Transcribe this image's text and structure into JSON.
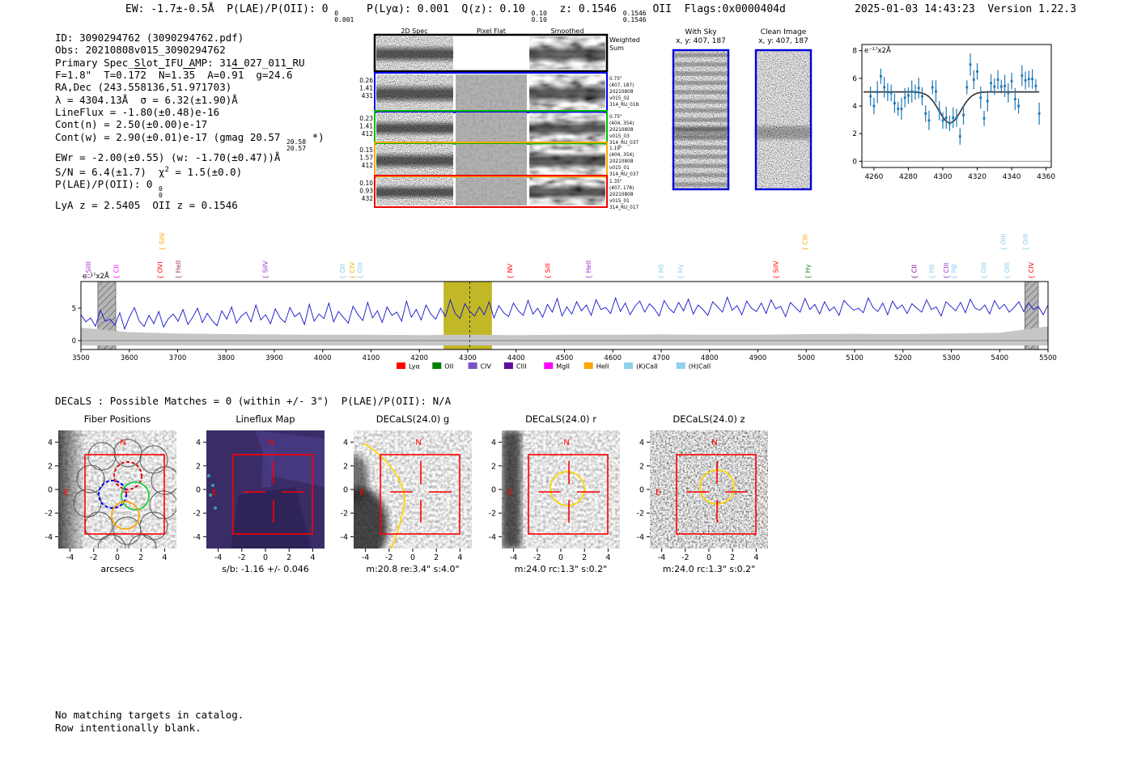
{
  "header": {
    "left_segments": [
      {
        "t": "EW: -1.7±-0.5Å  P(LAE)/P(OII): 0 "
      },
      {
        "stack": [
          "0",
          "0.001"
        ]
      },
      {
        "t": "  P(Lyα): 0.001  Q(z): 0.10 "
      },
      {
        "stack": [
          "0.10",
          "0.10"
        ]
      },
      {
        "t": "  z: 0.1546 "
      },
      {
        "stack": [
          "0.1546",
          "0.1546"
        ]
      },
      {
        "t": " OII  Flags:0x0000404d"
      }
    ],
    "right": "2025-01-03 14:43:23  Version 1.22.3"
  },
  "info_lines": [
    [
      {
        "t": "ID: 3090294762 (3090294762.pdf)"
      }
    ],
    [
      {
        "t": "Obs: 20210808v015_3090294762"
      }
    ],
    [
      {
        "t": "Primary Spec_Slot_IFU_AMP: 314_027_011_RU"
      }
    ],
    [
      {
        "t": "F=1.8\"  T=0.1"
      },
      {
        "t": "72",
        "over": true
      },
      {
        "t": "  "
      },
      {
        "t": "N",
        "over": true
      },
      {
        "t": "=1."
      },
      {
        "t": "35",
        "over": true
      },
      {
        "t": "  A=0."
      },
      {
        "t": "91",
        "over": true
      },
      {
        "t": "  g=24."
      },
      {
        "t": "6",
        "over": true
      }
    ],
    [
      {
        "t": "RA,Dec (243.558136,51.971703)"
      }
    ],
    [
      {
        "t": "λ = 4304.13Å  σ = 6.32(±1.90)Å"
      }
    ],
    [
      {
        "t": "LineFlux = -1.80(±0.48)e-16"
      }
    ],
    [
      {
        "t": "Cont(n) = 2.50(±0.00)e-17"
      }
    ],
    [
      {
        "t": "Cont(w) = 2.90(±0.01)e-17 (gmag 20.57 "
      },
      {
        "stack": [
          "20.58",
          "20.57"
        ]
      },
      {
        "t": " *)"
      }
    ],
    [
      {
        "t": "EWr = -2.00(±0.55) (w: -1.70(±0.47))Å"
      }
    ],
    [
      {
        "t": "S/N = 6.4(±1.7)  χ"
      },
      {
        "sup": "2"
      },
      {
        "t": " = 1.5(±0.0)"
      }
    ],
    [
      {
        "t": "P(LAE)/P(OII): 0 "
      },
      {
        "stack": [
          "0",
          "0"
        ]
      }
    ],
    [
      {
        "t": "LyA z = 2.5405  OII z = 0.1546"
      }
    ]
  ],
  "spec2d": {
    "columns": [
      "2D Spec",
      "Pixel Flat",
      "Smoothed"
    ],
    "rows": [
      {
        "border": "#000000",
        "left": [],
        "right": [
          "Weighted",
          "Sum"
        ]
      },
      {
        "border": "#0000ee",
        "left": [
          "0.26",
          "1.41",
          "431"
        ],
        "right": [
          "0.75\"",
          "(407, 187)",
          "20210808",
          "v015_02",
          "314_RU_018"
        ]
      },
      {
        "border": "#00bb00",
        "left": [
          "0.23",
          "1.41",
          "412"
        ],
        "right": [
          "0.75\"",
          "(404, 354)",
          "20210808",
          "v015_03",
          "314_RU_037"
        ]
      },
      {
        "border": "#ffa500",
        "left": [
          "0.15",
          "1.57",
          "412"
        ],
        "right": [
          "1.19\"",
          "(404, 354)",
          "20210808",
          "v015_01",
          "314_RU_037"
        ]
      },
      {
        "border": "#ee0000",
        "left": [
          "0.10",
          "0.93",
          "432"
        ],
        "right": [
          "1.35\"",
          "(407, 178)",
          "20210808",
          "v015_01",
          "314_RU_017"
        ]
      }
    ]
  },
  "sky_panels": {
    "with_sky_title": "With Sky",
    "with_sky_sub": "x, y: 407, 187",
    "clean_title": "Clean Image",
    "clean_sub": "x, y: 407, 187",
    "border_color": "#0000dd"
  },
  "decals": {
    "match_line": "DECaLS : Possible Matches = 0 (within +/- 3\")  P(LAE)/P(OII): N/A"
  },
  "footer_lines": [
    "No matching targets in catalog.",
    "Row intentionally blank."
  ],
  "chart_data": [
    {
      "id": "line_fit",
      "type": "scatter",
      "inset_label": "e⁻¹⁷x2Å",
      "xlim": [
        4253,
        4363
      ],
      "ylim": [
        -0.45,
        8.45
      ],
      "x_ticks": [
        4260,
        4280,
        4300,
        4320,
        4340,
        4360
      ],
      "y_ticks": [
        0,
        2,
        4,
        6,
        8
      ],
      "point_color": "#1f77b4",
      "fit_color": "#3a3a3a",
      "fit": {
        "continuum": 5.02,
        "center": 4304.13,
        "sigma": 6.32,
        "depth": 2.25
      },
      "x_start": 4258,
      "x_step": 2,
      "points_y": [
        4.7,
        4.0,
        5.0,
        6.15,
        5.35,
        5.0,
        4.95,
        4.2,
        3.8,
        3.8,
        4.6,
        4.75,
        5.05,
        5.0,
        5.3,
        4.7,
        3.45,
        2.95,
        5.35,
        5.05,
        3.65,
        2.95,
        3.15,
        2.75,
        3.15,
        3.15,
        1.8,
        3.35,
        5.35,
        7.0,
        5.9,
        6.5,
        4.6,
        3.1,
        4.35,
        5.65,
        5.4,
        5.9,
        5.4,
        5.45,
        4.95,
        5.8,
        4.5,
        4.0,
        6.2,
        5.85,
        5.95,
        5.95,
        5.45,
        3.45
      ],
      "points_err_cycle": [
        0.7,
        0.6,
        0.8,
        0.55,
        0.75,
        0.65,
        0.6,
        0.7,
        0.5,
        0.8
      ]
    },
    {
      "id": "main_spectrum",
      "type": "line",
      "inset_label": "e⁻¹⁷x2Å",
      "xlim": [
        3500,
        5500
      ],
      "ylim": [
        -1.4,
        9.1
      ],
      "x_ticks": [
        3500,
        3600,
        3700,
        3800,
        3900,
        4000,
        4100,
        4200,
        4300,
        4400,
        4500,
        4600,
        4700,
        4800,
        4900,
        5000,
        5100,
        5200,
        5300,
        5400,
        5500
      ],
      "y_ticks": [
        0,
        5
      ],
      "line_color": "#1414cc",
      "highlight": {
        "x0": 4250,
        "x1": 4350,
        "line_x": 4304.13,
        "color": "#bfb31b"
      },
      "masked_bands": [
        [
          3535,
          3572
        ],
        [
          5452,
          5480
        ]
      ],
      "err_band_top": [
        2.0,
        1.3,
        1.1,
        1.0,
        0.95,
        0.9,
        0.9,
        0.85,
        0.9,
        0.85,
        0.9,
        0.9,
        0.95,
        0.9,
        0.9,
        1.0,
        1.05,
        1.0,
        1.1,
        1.2,
        2.2
      ],
      "flux": [
        4.0,
        2.9,
        3.5,
        2.2,
        4.7,
        3.0,
        3.3,
        2.4,
        4.3,
        1.8,
        3.7,
        5.1,
        3.0,
        2.2,
        3.9,
        2.6,
        4.5,
        2.1,
        3.4,
        4.1,
        3.0,
        4.8,
        2.5,
        3.6,
        5.0,
        2.8,
        4.2,
        3.1,
        2.3,
        4.6,
        3.3,
        5.2,
        2.7,
        3.8,
        4.4,
        2.9,
        5.5,
        3.2,
        4.0,
        2.6,
        4.9,
        3.5,
        2.8,
        5.1,
        3.7,
        4.3,
        2.5,
        5.6,
        3.0,
        4.1,
        3.4,
        5.8,
        2.9,
        4.5,
        3.6,
        2.7,
        5.3,
        4.0,
        3.1,
        5.9,
        3.5,
        4.6,
        2.8,
        5.2,
        3.9,
        4.4,
        3.0,
        6.1,
        3.6,
        4.8,
        3.2,
        5.5,
        4.1,
        3.3,
        5.0,
        3.7,
        6.3,
        4.2,
        3.4,
        5.7,
        4.5,
        3.8,
        5.2,
        4.0,
        6.0,
        3.5,
        5.4,
        4.3,
        3.7,
        5.8,
        4.6,
        3.9,
        6.2,
        4.1,
        5.0,
        3.6,
        5.6,
        4.4,
        6.5,
        3.8,
        5.2,
        4.1,
        6.0,
        4.6,
        5.5,
        3.9,
        6.3,
        4.8,
        5.1,
        4.2,
        6.6,
        4.5,
        5.8,
        4.0,
        5.3,
        6.1,
        4.4,
        5.7,
        4.9,
        3.8,
        6.2,
        5.0,
        4.3,
        5.9,
        4.6,
        6.4,
        4.1,
        5.5,
        4.8,
        3.9,
        6.0,
        5.2,
        4.4,
        6.7,
        4.7,
        5.4,
        4.0,
        6.1,
        5.0,
        4.5,
        5.8,
        4.2,
        6.3,
        4.9,
        5.3,
        3.7,
        5.9,
        5.1,
        4.4,
        6.5,
        4.8,
        5.6,
        4.1,
        6.0,
        4.6,
        5.2,
        3.9,
        6.2,
        5.4,
        4.7,
        5.0,
        4.3,
        6.6,
        5.1,
        4.5,
        5.8,
        4.0,
        6.1,
        4.9,
        5.5,
        4.2,
        5.7,
        5.0,
        4.4,
        6.3,
        4.8,
        5.2,
        3.8,
        6.0,
        5.3,
        4.6,
        5.9,
        4.3,
        6.4,
        5.0,
        4.7,
        5.5,
        4.1,
        6.2,
        4.9,
        5.6,
        4.4,
        5.1,
        6.0,
        4.5,
        5.8,
        4.8,
        5.3,
        4.0,
        5.5
      ],
      "line_labels": [
        {
          "label": "SiIII",
          "wl": 3520,
          "color": "#9a32cd",
          "row": 0
        },
        {
          "label": "CII",
          "wl": 3578,
          "color": "#ff00ff",
          "row": 0
        },
        {
          "label": "SiIV",
          "wl": 3672,
          "color": "#ffa500",
          "row": 1
        },
        {
          "label": "OVI",
          "wl": 3668,
          "color": "#ff0000",
          "row": 0
        },
        {
          "label": "HeII",
          "wl": 3706,
          "color": "#a03568",
          "row": 0
        },
        {
          "label": "SiIV",
          "wl": 3886,
          "color": "#9a32cd",
          "row": 0
        },
        {
          "label": "OII",
          "wl": 4046,
          "color": "#87ceeb",
          "row": 0
        },
        {
          "label": "CIV",
          "wl": 4066,
          "color": "#ffa500",
          "row": 0
        },
        {
          "label": "OIII",
          "wl": 4082,
          "color": "#87ceeb",
          "row": 0
        },
        {
          "label": "NV",
          "wl": 4392,
          "color": "#ff0000",
          "row": 0
        },
        {
          "label": "SiII",
          "wl": 4470,
          "color": "#ff0000",
          "row": 0
        },
        {
          "label": "HeII",
          "wl": 4554,
          "color": "#9a32cd",
          "row": 0
        },
        {
          "label": "Hδ",
          "wl": 4704,
          "color": "#87ceeb",
          "row": 0
        },
        {
          "label": "Hγ",
          "wl": 4744,
          "color": "#87ceeb",
          "row": 0
        },
        {
          "label": "SiIV",
          "wl": 4942,
          "color": "#ff0000",
          "row": 0
        },
        {
          "label": "CIII",
          "wl": 5002,
          "color": "#ffa500",
          "row": 1
        },
        {
          "label": "Hγ",
          "wl": 5008,
          "color": "#228b22",
          "row": 0
        },
        {
          "label": "CII",
          "wl": 5228,
          "color": "#8b008b",
          "row": 0
        },
        {
          "label": "Hδ",
          "wl": 5264,
          "color": "#87ceeb",
          "row": 0
        },
        {
          "label": "CIII",
          "wl": 5294,
          "color": "#9a32cd",
          "row": 0
        },
        {
          "label": "Hβ",
          "wl": 5310,
          "color": "#87ceeb",
          "row": 0
        },
        {
          "label": "OIII",
          "wl": 5372,
          "color": "#87ceeb",
          "row": 0
        },
        {
          "label": "OIII",
          "wl": 5420,
          "color": "#87ceeb",
          "row": 0
        },
        {
          "label": "OIII",
          "wl": 5412,
          "color": "#87ceeb",
          "row": 1
        },
        {
          "label": "OIII",
          "wl": 5458,
          "color": "#87ceeb",
          "row": 1
        },
        {
          "label": "CIV",
          "wl": 5470,
          "color": "#ff0000",
          "row": 0
        }
      ],
      "legend": [
        {
          "label": "Lyα",
          "color": "#ff0000"
        },
        {
          "label": "OII",
          "color": "#008000"
        },
        {
          "label": "CIV",
          "color": "#7a52c7"
        },
        {
          "label": "CIII",
          "color": "#5d0f9e"
        },
        {
          "label": "MgII",
          "color": "#ff00ff"
        },
        {
          "label": "HeII",
          "color": "#ffa500"
        },
        {
          "label": "(K)CaII",
          "color": "#8ed1ee"
        },
        {
          "label": "(H)CaII",
          "color": "#8ed1ee"
        }
      ]
    }
  ],
  "cutouts": [
    {
      "id": "fiber",
      "title": "Fiber Positions",
      "xlabel": "arcsecs",
      "x_ticks": [
        -4,
        -2,
        0,
        2,
        4
      ],
      "y_ticks": [
        4,
        2,
        0,
        -2,
        -4
      ],
      "north": "N",
      "east": "E"
    },
    {
      "id": "lineflux",
      "title": "Lineflux Map",
      "xlabel": "s/b: -1.16 +/- 0.046",
      "x_ticks": [
        -4,
        -2,
        0,
        2,
        4
      ],
      "y_ticks": [
        4,
        2,
        0,
        -2,
        -4
      ],
      "north": "N",
      "east": "E"
    },
    {
      "id": "decals_g",
      "title": "DECaLS(24.0) g",
      "xlabel": "m:20.8 re:3.4\" s:4.0\"",
      "x_ticks": [
        -4,
        -2,
        0,
        2,
        4
      ],
      "y_ticks": [
        4,
        2,
        0,
        -2,
        -4
      ],
      "north": "N",
      "east": "E"
    },
    {
      "id": "decals_r",
      "title": "DECaLS(24.0) r",
      "xlabel": "m:24.0 rc:1.3\" s:0.2\"",
      "x_ticks": [
        -4,
        -2,
        0,
        2,
        4
      ],
      "y_ticks": [
        4,
        2,
        0,
        -2,
        -4
      ],
      "north": "N",
      "east": "E"
    },
    {
      "id": "decals_z",
      "title": "DECaLS(24.0) z",
      "xlabel": "m:24.0 rc:1.3\" s:0.2\"",
      "x_ticks": [
        -4,
        -2,
        0,
        2,
        4
      ],
      "y_ticks": [
        4,
        2,
        0,
        -2,
        -4
      ],
      "north": "N",
      "east": "E"
    }
  ],
  "colors": {
    "accent_red": "#ff0000",
    "marker_yellow": "#ffd700",
    "lineflux_bg": "#3a2c66"
  }
}
